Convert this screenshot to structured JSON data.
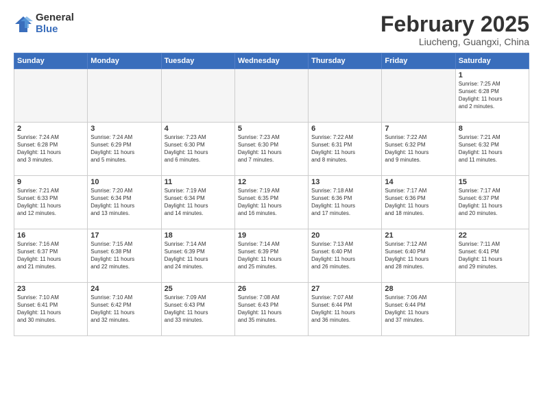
{
  "header": {
    "logo_general": "General",
    "logo_blue": "Blue",
    "title": "February 2025",
    "subtitle": "Liucheng, Guangxi, China"
  },
  "weekdays": [
    "Sunday",
    "Monday",
    "Tuesday",
    "Wednesday",
    "Thursday",
    "Friday",
    "Saturday"
  ],
  "weeks": [
    [
      {
        "day": "",
        "info": ""
      },
      {
        "day": "",
        "info": ""
      },
      {
        "day": "",
        "info": ""
      },
      {
        "day": "",
        "info": ""
      },
      {
        "day": "",
        "info": ""
      },
      {
        "day": "",
        "info": ""
      },
      {
        "day": "1",
        "info": "Sunrise: 7:25 AM\nSunset: 6:28 PM\nDaylight: 11 hours\nand 2 minutes."
      }
    ],
    [
      {
        "day": "2",
        "info": "Sunrise: 7:24 AM\nSunset: 6:28 PM\nDaylight: 11 hours\nand 3 minutes."
      },
      {
        "day": "3",
        "info": "Sunrise: 7:24 AM\nSunset: 6:29 PM\nDaylight: 11 hours\nand 5 minutes."
      },
      {
        "day": "4",
        "info": "Sunrise: 7:23 AM\nSunset: 6:30 PM\nDaylight: 11 hours\nand 6 minutes."
      },
      {
        "day": "5",
        "info": "Sunrise: 7:23 AM\nSunset: 6:30 PM\nDaylight: 11 hours\nand 7 minutes."
      },
      {
        "day": "6",
        "info": "Sunrise: 7:22 AM\nSunset: 6:31 PM\nDaylight: 11 hours\nand 8 minutes."
      },
      {
        "day": "7",
        "info": "Sunrise: 7:22 AM\nSunset: 6:32 PM\nDaylight: 11 hours\nand 9 minutes."
      },
      {
        "day": "8",
        "info": "Sunrise: 7:21 AM\nSunset: 6:32 PM\nDaylight: 11 hours\nand 11 minutes."
      }
    ],
    [
      {
        "day": "9",
        "info": "Sunrise: 7:21 AM\nSunset: 6:33 PM\nDaylight: 11 hours\nand 12 minutes."
      },
      {
        "day": "10",
        "info": "Sunrise: 7:20 AM\nSunset: 6:34 PM\nDaylight: 11 hours\nand 13 minutes."
      },
      {
        "day": "11",
        "info": "Sunrise: 7:19 AM\nSunset: 6:34 PM\nDaylight: 11 hours\nand 14 minutes."
      },
      {
        "day": "12",
        "info": "Sunrise: 7:19 AM\nSunset: 6:35 PM\nDaylight: 11 hours\nand 16 minutes."
      },
      {
        "day": "13",
        "info": "Sunrise: 7:18 AM\nSunset: 6:36 PM\nDaylight: 11 hours\nand 17 minutes."
      },
      {
        "day": "14",
        "info": "Sunrise: 7:17 AM\nSunset: 6:36 PM\nDaylight: 11 hours\nand 18 minutes."
      },
      {
        "day": "15",
        "info": "Sunrise: 7:17 AM\nSunset: 6:37 PM\nDaylight: 11 hours\nand 20 minutes."
      }
    ],
    [
      {
        "day": "16",
        "info": "Sunrise: 7:16 AM\nSunset: 6:37 PM\nDaylight: 11 hours\nand 21 minutes."
      },
      {
        "day": "17",
        "info": "Sunrise: 7:15 AM\nSunset: 6:38 PM\nDaylight: 11 hours\nand 22 minutes."
      },
      {
        "day": "18",
        "info": "Sunrise: 7:14 AM\nSunset: 6:39 PM\nDaylight: 11 hours\nand 24 minutes."
      },
      {
        "day": "19",
        "info": "Sunrise: 7:14 AM\nSunset: 6:39 PM\nDaylight: 11 hours\nand 25 minutes."
      },
      {
        "day": "20",
        "info": "Sunrise: 7:13 AM\nSunset: 6:40 PM\nDaylight: 11 hours\nand 26 minutes."
      },
      {
        "day": "21",
        "info": "Sunrise: 7:12 AM\nSunset: 6:40 PM\nDaylight: 11 hours\nand 28 minutes."
      },
      {
        "day": "22",
        "info": "Sunrise: 7:11 AM\nSunset: 6:41 PM\nDaylight: 11 hours\nand 29 minutes."
      }
    ],
    [
      {
        "day": "23",
        "info": "Sunrise: 7:10 AM\nSunset: 6:41 PM\nDaylight: 11 hours\nand 30 minutes."
      },
      {
        "day": "24",
        "info": "Sunrise: 7:10 AM\nSunset: 6:42 PM\nDaylight: 11 hours\nand 32 minutes."
      },
      {
        "day": "25",
        "info": "Sunrise: 7:09 AM\nSunset: 6:43 PM\nDaylight: 11 hours\nand 33 minutes."
      },
      {
        "day": "26",
        "info": "Sunrise: 7:08 AM\nSunset: 6:43 PM\nDaylight: 11 hours\nand 35 minutes."
      },
      {
        "day": "27",
        "info": "Sunrise: 7:07 AM\nSunset: 6:44 PM\nDaylight: 11 hours\nand 36 minutes."
      },
      {
        "day": "28",
        "info": "Sunrise: 7:06 AM\nSunset: 6:44 PM\nDaylight: 11 hours\nand 37 minutes."
      },
      {
        "day": "",
        "info": ""
      }
    ]
  ]
}
